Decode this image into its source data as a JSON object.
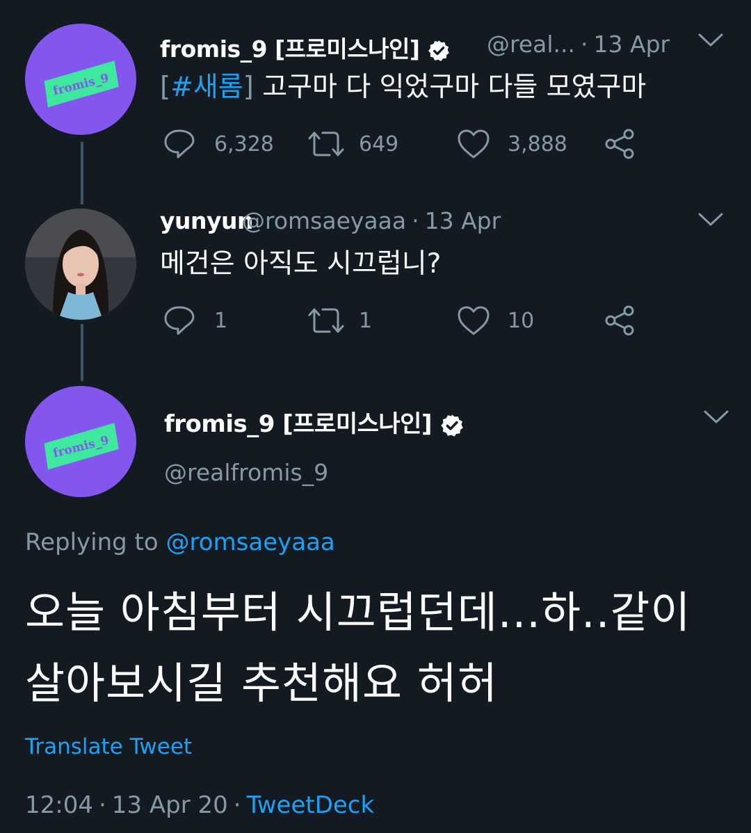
{
  "tweet1": {
    "name": "fromis_9 [프로미스나인]",
    "handle": "@real...",
    "time": "13 Apr",
    "text_open": "[",
    "hashtag": "#새롬",
    "text_close": "]",
    "text_rest": "고구마 다 익었구마 다들 모였구마",
    "avatar_text": "fromis_9",
    "replies": "6,328",
    "retweets": "649",
    "likes": "3,888"
  },
  "tweet2": {
    "name": "yunyun",
    "handle": "@romsaeyaaa",
    "time": "13 Apr",
    "text": "메건은 아직도 시끄럽니?",
    "replies": "1",
    "retweets": "1",
    "likes": "10"
  },
  "main": {
    "name": "fromis_9 [프로미스나인]",
    "handle": "@realfromis_9",
    "avatar_text": "fromis_9",
    "replying_label": "Replying to",
    "replying_to": "@romsaeyaaa",
    "text_line1": "오늘 아침부터 시끄럽던데...하..같이",
    "text_line2": "살아보시길 추천해요 허허",
    "translate": "Translate Tweet",
    "timestamp": "12:04",
    "date": "13 Apr 20",
    "source": "TweetDeck"
  },
  "icons": [
    "reply-icon",
    "retweet-icon",
    "like-icon",
    "share-icon",
    "verified-icon",
    "chevron-down-icon"
  ],
  "colors": {
    "background": "#131a22",
    "secondary_text": "#8899a6",
    "link": "#1da1f2",
    "avatar_purple": "#8356ee",
    "avatar_green": "#3ee89e"
  }
}
